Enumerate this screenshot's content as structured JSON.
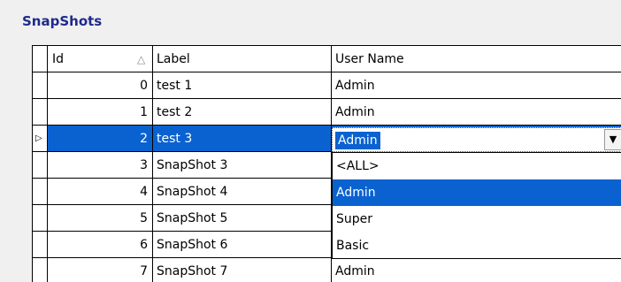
{
  "panel": {
    "title": "SnapShots"
  },
  "grid": {
    "headers": {
      "id": "Id",
      "label": "Label",
      "user": "User Name"
    },
    "rows": [
      {
        "id": "0",
        "label": "test 1",
        "user": "Admin"
      },
      {
        "id": "1",
        "label": "test 2",
        "user": "Admin"
      },
      {
        "id": "2",
        "label": "test 3",
        "user": "Admin"
      },
      {
        "id": "3",
        "label": "SnapShot 3",
        "user": ""
      },
      {
        "id": "4",
        "label": "SnapShot 4",
        "user": ""
      },
      {
        "id": "5",
        "label": "SnapShot 5",
        "user": ""
      },
      {
        "id": "6",
        "label": "SnapShot 6",
        "user": ""
      },
      {
        "id": "7",
        "label": "SnapShot 7",
        "user": "Admin"
      }
    ],
    "selected_row": 2
  },
  "dropdown": {
    "value": "Admin",
    "options": [
      "<ALL>",
      "Admin",
      "Super",
      "Basic"
    ],
    "highlighted": "Admin"
  },
  "icons": {
    "sort": "sort-ascending-icon",
    "row_indicator": "current-row-icon",
    "dropdown": "chevron-down-icon"
  },
  "colors": {
    "title": "#1f2a8c",
    "selection": "#0a62d0"
  }
}
